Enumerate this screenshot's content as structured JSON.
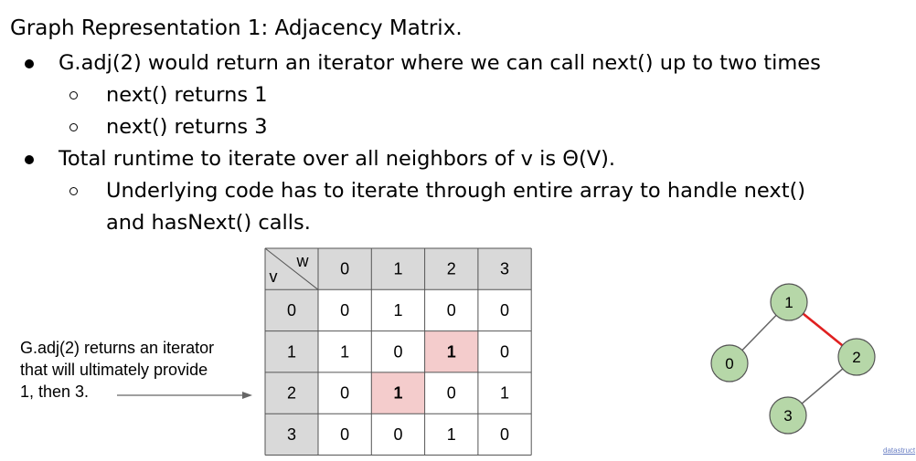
{
  "title": "Graph Representation 1: Adjacency Matrix.",
  "bullets": {
    "b1": "G.adj(2) would return an iterator where we can call next() up to two times",
    "b1_sub1": "next() returns 1",
    "b1_sub2": "next() returns 3",
    "b2": "Total runtime to iterate over all neighbors of v is Θ(V).",
    "b2_sub1_line1": "Underlying code has to iterate through entire array to handle next()",
    "b2_sub1_line2": "and hasNext() calls."
  },
  "note": {
    "line1": "G.adj(2) returns an iterator",
    "line2": "that will ultimately provide",
    "line3": "1, then 3."
  },
  "matrix": {
    "corner_w": "w",
    "corner_v": "v",
    "col_headers": [
      "0",
      "1",
      "2",
      "3"
    ],
    "row_headers": [
      "0",
      "1",
      "2",
      "3"
    ],
    "rows": [
      [
        "0",
        "1",
        "0",
        "0"
      ],
      [
        "1",
        "0",
        "1",
        "0"
      ],
      [
        "0",
        "1",
        "0",
        "1"
      ],
      [
        "0",
        "0",
        "1",
        "0"
      ]
    ],
    "highlighted_cells": [
      [
        1,
        2
      ],
      [
        2,
        1
      ]
    ],
    "colors": {
      "header_bg": "#d9d9d9",
      "highlight_bg": "#f4cccc",
      "border": "#555555"
    }
  },
  "graph": {
    "nodes": [
      "0",
      "1",
      "2",
      "3"
    ],
    "edges": [
      [
        "0",
        "1"
      ],
      [
        "1",
        "2"
      ],
      [
        "2",
        "3"
      ]
    ],
    "highlighted_edge": [
      "1",
      "2"
    ],
    "colors": {
      "node_fill": "#b6d7a8",
      "node_stroke": "#555555",
      "edge": "#666666",
      "highlight_edge": "#e02020"
    }
  },
  "footer_text": "datastruct"
}
